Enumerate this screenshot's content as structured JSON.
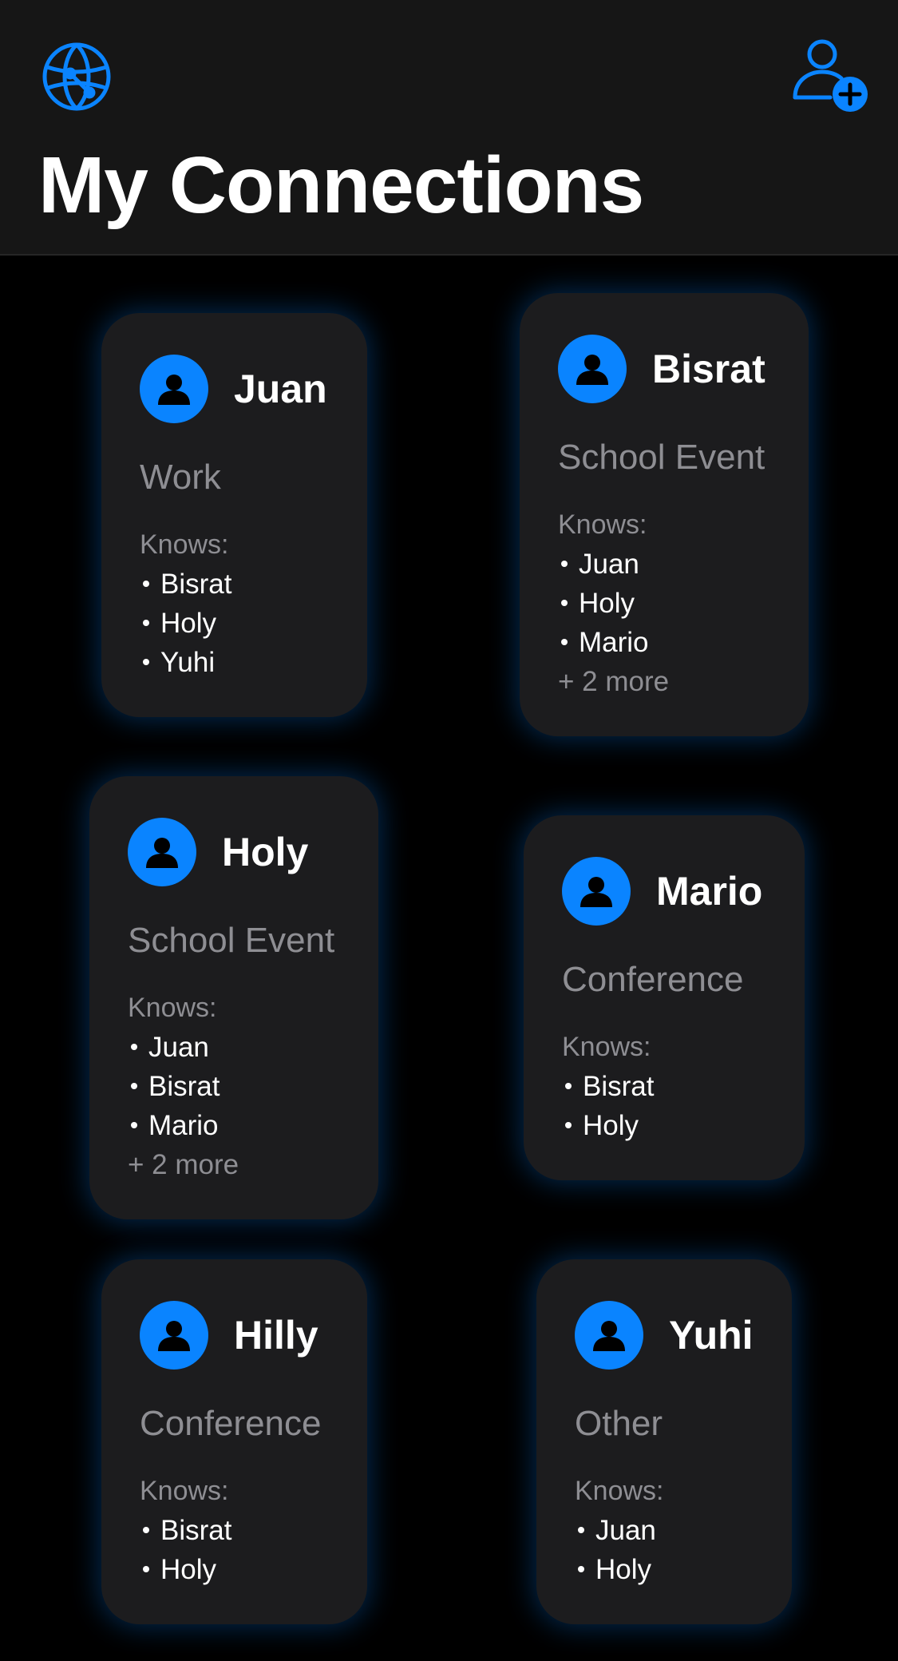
{
  "header": {
    "title": "My Connections",
    "left_icon": "globe-network-icon",
    "right_icon": "person-add-icon"
  },
  "colors": {
    "accent": "#0a84ff",
    "card_background": "#1c1c1e",
    "header_background": "#161616",
    "secondary_text": "#8e8e93"
  },
  "knows_label": "Knows:",
  "connections": [
    {
      "name": "Juan",
      "context": "Work",
      "knows": [
        "Bisrat",
        "Holy",
        "Yuhi"
      ],
      "more": ""
    },
    {
      "name": "Bisrat",
      "context": "School Event",
      "knows": [
        "Juan",
        "Holy",
        "Mario"
      ],
      "more": "+ 2 more"
    },
    {
      "name": "Holy",
      "context": "School Event",
      "knows": [
        "Juan",
        "Bisrat",
        "Mario"
      ],
      "more": "+ 2 more"
    },
    {
      "name": "Mario",
      "context": "Conference",
      "knows": [
        "Bisrat",
        "Holy"
      ],
      "more": ""
    },
    {
      "name": "Hilly",
      "context": "Conference",
      "knows": [
        "Bisrat",
        "Holy"
      ],
      "more": ""
    },
    {
      "name": "Yuhi",
      "context": "Other",
      "knows": [
        "Juan",
        "Holy"
      ],
      "more": ""
    }
  ]
}
